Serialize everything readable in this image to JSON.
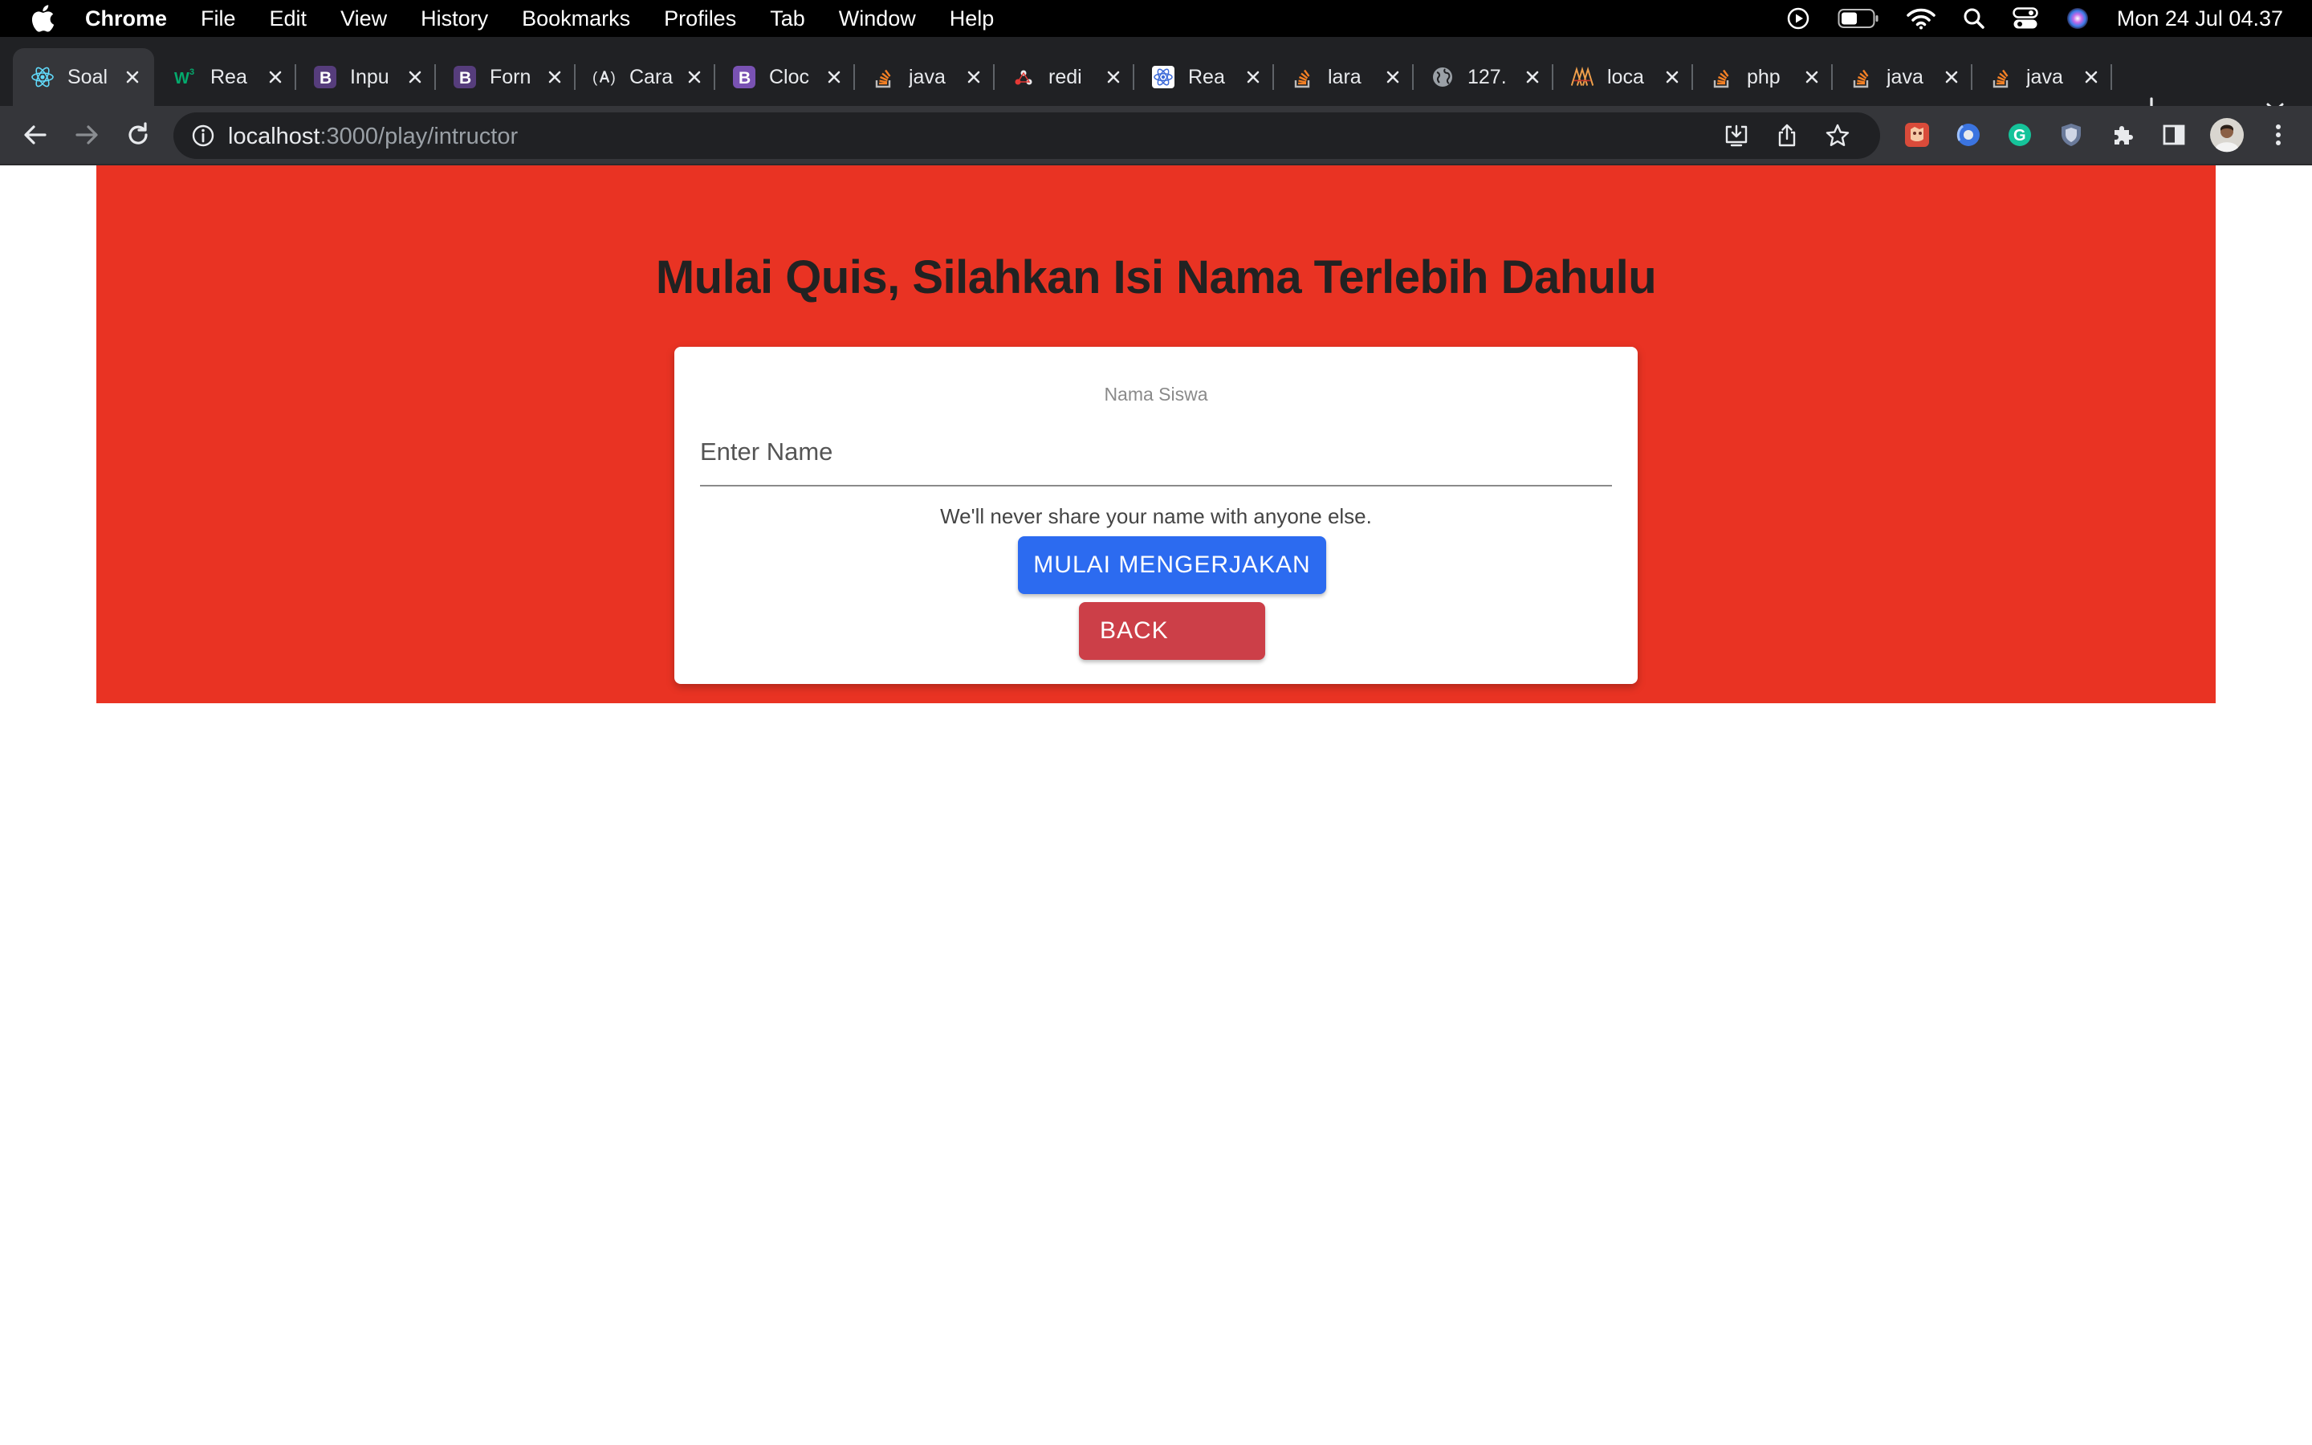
{
  "menubar": {
    "app_name": "Chrome",
    "items": [
      "File",
      "Edit",
      "View",
      "History",
      "Bookmarks",
      "Profiles",
      "Tab",
      "Window",
      "Help"
    ],
    "clock": "Mon 24 Jul  04.37"
  },
  "tabs": [
    {
      "title": "Soal",
      "icon": "react-icon",
      "active": true
    },
    {
      "title": "Rea",
      "icon": "w3schools-icon"
    },
    {
      "title": "Inpu",
      "icon": "bootstrap-icon"
    },
    {
      "title": "Forn",
      "icon": "bootstrap-icon"
    },
    {
      "title": "Cara",
      "icon": "angular-icon"
    },
    {
      "title": "Cloc",
      "icon": "bootstrap-icon"
    },
    {
      "title": "java",
      "icon": "stackoverflow-icon"
    },
    {
      "title": "redi",
      "icon": "redux-icon"
    },
    {
      "title": "Rea",
      "icon": "react-icon"
    },
    {
      "title": "lara",
      "icon": "stackoverflow-icon"
    },
    {
      "title": "127.",
      "icon": "globe-icon"
    },
    {
      "title": "loca",
      "icon": "xampp-icon"
    },
    {
      "title": "php",
      "icon": "stackoverflow-icon"
    },
    {
      "title": "java",
      "icon": "stackoverflow-icon"
    },
    {
      "title": "java",
      "icon": "stackoverflow-icon"
    }
  ],
  "address_bar": {
    "host": "localhost",
    "path": ":3000/play/intructor"
  },
  "colors": {
    "hero_background": "#e93323",
    "primary_button": "#2c6bf0",
    "danger_button": "#cc3f48"
  },
  "page": {
    "heading": "Mulai Quis, Silahkan Isi Nama Terlebih Dahulu",
    "form": {
      "label": "Nama Siswa",
      "input_placeholder": "Enter Name",
      "input_value": "",
      "help_text": "We'll never share your name with anyone else.",
      "start_button": "MULAI MENGERJAKAN",
      "back_button": "BACK"
    }
  }
}
